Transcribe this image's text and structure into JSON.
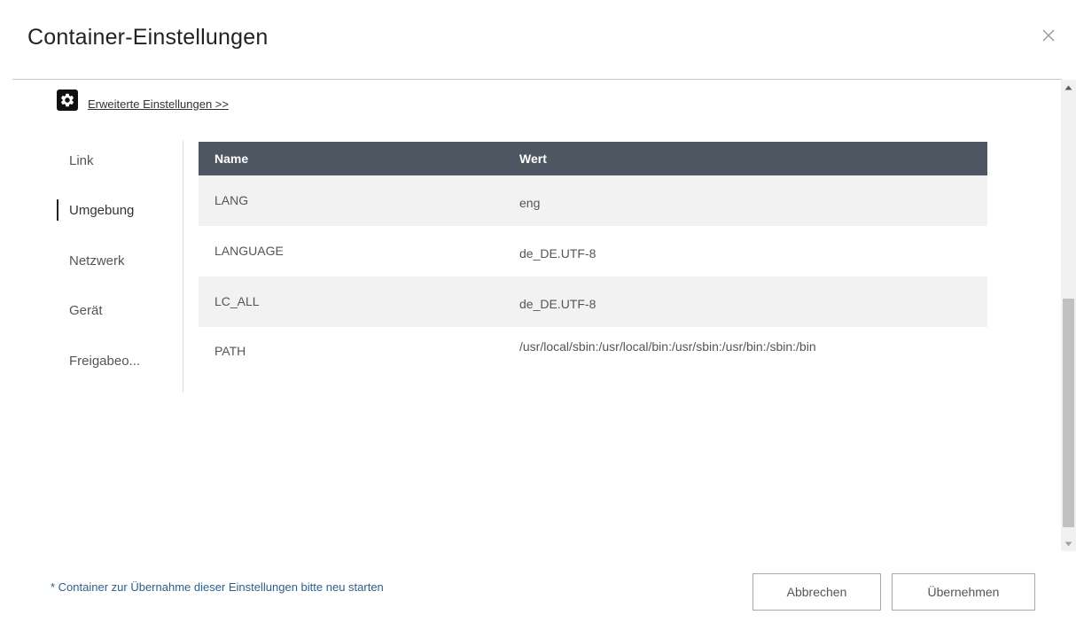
{
  "dialog": {
    "title": "Container-Einstellungen",
    "close_icon": "close-icon"
  },
  "advanced": {
    "icon": "gear-icon",
    "link_label": "Erweiterte Einstellungen >>"
  },
  "sidebar": {
    "items": [
      {
        "label": "Link",
        "active": false
      },
      {
        "label": "Umgebung",
        "active": true
      },
      {
        "label": "Netzwerk",
        "active": false
      },
      {
        "label": "Gerät",
        "active": false
      },
      {
        "label": "Freigabeo...",
        "active": false
      }
    ]
  },
  "table": {
    "headers": {
      "name": "Name",
      "value": "Wert"
    },
    "rows": [
      {
        "name": "LANG",
        "value": "eng"
      },
      {
        "name": "LANGUAGE",
        "value": "de_DE.UTF-8"
      },
      {
        "name": "LC_ALL",
        "value": "de_DE.UTF-8"
      },
      {
        "name": "PATH",
        "value": "/usr/local/sbin:/usr/local/bin:/usr/sbin:/usr/bin:/sbin:/bin"
      }
    ]
  },
  "footer": {
    "note": "* Container zur Übernahme dieser Einstellungen bitte neu starten",
    "cancel_label": "Abbrechen",
    "apply_label": "Übernehmen"
  },
  "colors": {
    "table_header_bg": "#4e5661",
    "row_stripe": "#f2f2f2",
    "note_text": "#2a5f94"
  }
}
